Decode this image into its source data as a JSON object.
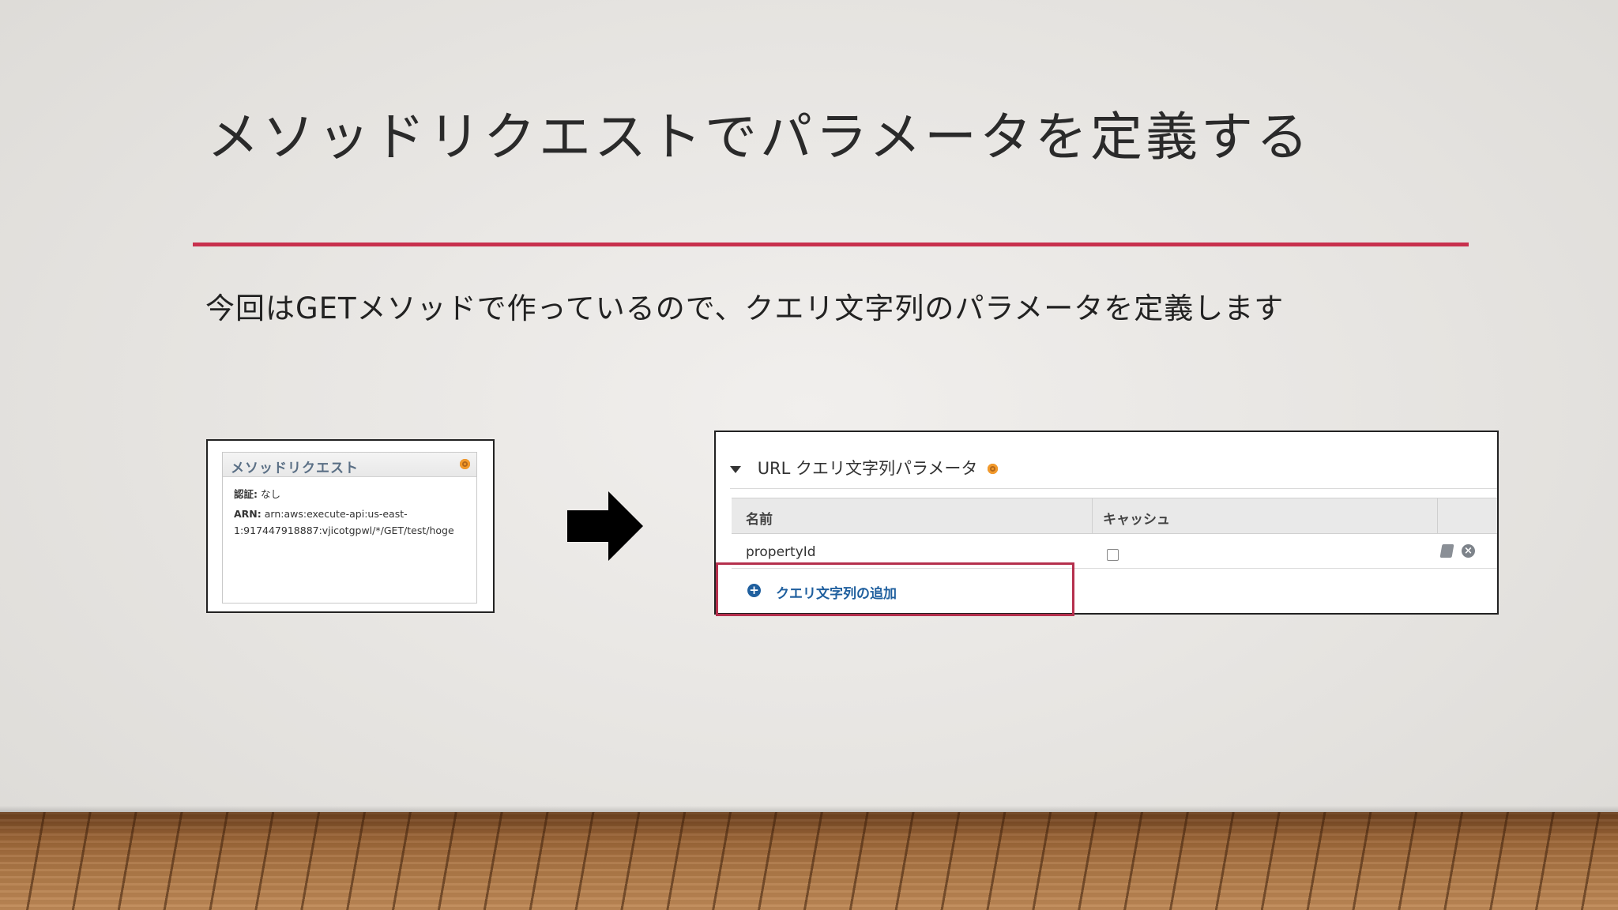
{
  "slide": {
    "title": "メソッドリクエストでパラメータを定義する",
    "subtitle": "今回はGETメソッドで作っているので、クエリ文字列のパラメータを定義します"
  },
  "method_request_panel": {
    "title": "メソッドリクエスト",
    "auth_label": "認証:",
    "auth_value": "なし",
    "arn_label": "ARN:",
    "arn_line1": "arn:aws:execute-api:us-east-",
    "arn_line2": "1:917447918887:vjicotgpwl/*/GET/test/hoge"
  },
  "query_params_panel": {
    "header": "URL クエリ文字列パラメータ",
    "columns": [
      "名前",
      "キャッシュ"
    ],
    "rows": [
      {
        "name": "propertyId",
        "cache": false
      }
    ],
    "add_link": "クエリ文字列の追加"
  },
  "colors": {
    "accent_rule": "#c8304d",
    "highlight_box": "#b5304d",
    "link_blue": "#1f5f9e",
    "info_orange": "#f39a2b"
  },
  "icons": [
    "info-icon",
    "right-arrow-icon",
    "collapse-triangle-icon",
    "edit-icon",
    "delete-icon",
    "add-circle-icon"
  ]
}
